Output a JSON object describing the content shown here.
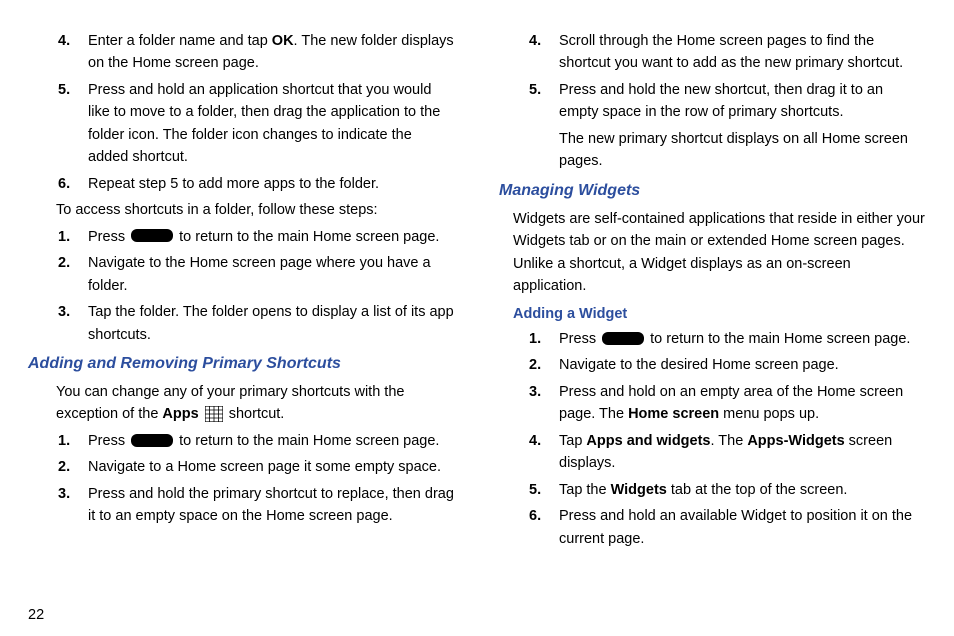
{
  "page_number": "22",
  "left": {
    "list1": [
      {
        "n": "4.",
        "pre": "Enter a folder name and tap ",
        "bold": "OK",
        "post": ". The new folder displays on the Home screen page."
      },
      {
        "n": "5.",
        "pre": "Press and hold an application shortcut that you would like to move to a folder, then drag the application to the folder icon. The folder icon changes to indicate the added shortcut.",
        "bold": "",
        "post": ""
      },
      {
        "n": "6.",
        "pre": "Repeat step 5 to add more apps to the folder.",
        "bold": "",
        "post": ""
      }
    ],
    "access_intro": "To access shortcuts in a folder, follow these steps:",
    "list2_item1_pre": "Press ",
    "list2_item1_post": " to return to the main Home screen page.",
    "list2": [
      {
        "n": "2.",
        "text": "Navigate to the Home screen page where you have a folder."
      },
      {
        "n": "3.",
        "text": "Tap the folder. The folder opens to display a list of its app shortcuts."
      }
    ],
    "heading1": "Adding and Removing Primary Shortcuts",
    "primary_intro_1": "You can change any of your primary shortcuts with the exception of the ",
    "primary_intro_bold": "Apps",
    "primary_intro_2": " shortcut.",
    "list3_item1_pre": "Press ",
    "list3_item1_post": " to return to the main Home screen page.",
    "list3": [
      {
        "n": "2.",
        "text": "Navigate to a Home screen page it some empty space."
      },
      {
        "n": "3.",
        "text": "Press and hold the primary shortcut to replace, then drag it to an empty space on the Home screen page."
      }
    ],
    "num1": "1.",
    "num1b": "1."
  },
  "right": {
    "list1": [
      {
        "n": "4.",
        "text": "Scroll through the Home screen pages to find the shortcut you want to add as the new primary shortcut."
      },
      {
        "n": "5.",
        "text": "Press and hold the new shortcut, then drag it to an empty space in the row of primary shortcuts."
      }
    ],
    "cont": "The new primary shortcut displays on all Home screen pages.",
    "heading1": "Managing Widgets",
    "widgets_intro": "Widgets are self-contained applications that reside in either your Widgets tab or on the main or extended Home screen pages. Unlike a shortcut, a Widget displays as an on-screen application.",
    "heading2": "Adding a Widget",
    "list2_item1_pre": "Press ",
    "list2_item1_post": " to return to the main Home screen page.",
    "num1": "1.",
    "list2_item2": {
      "n": "2.",
      "text": "Navigate to the desired Home screen page."
    },
    "list2_item3": {
      "n": "3.",
      "pre": "Press and hold on an empty area of the Home screen page. The ",
      "b1": "Home screen",
      "post": " menu pops up."
    },
    "list2_item4": {
      "n": "4.",
      "pre": "Tap ",
      "b1": "Apps and widgets",
      "mid": ". The ",
      "b2": "Apps-Widgets",
      "post": " screen displays."
    },
    "list2_item5": {
      "n": "5.",
      "pre": "Tap the ",
      "b1": "Widgets",
      "post": " tab at the top of the screen."
    },
    "list2_item6": {
      "n": "6.",
      "text": "Press and hold an available Widget to position it on the current page."
    }
  }
}
